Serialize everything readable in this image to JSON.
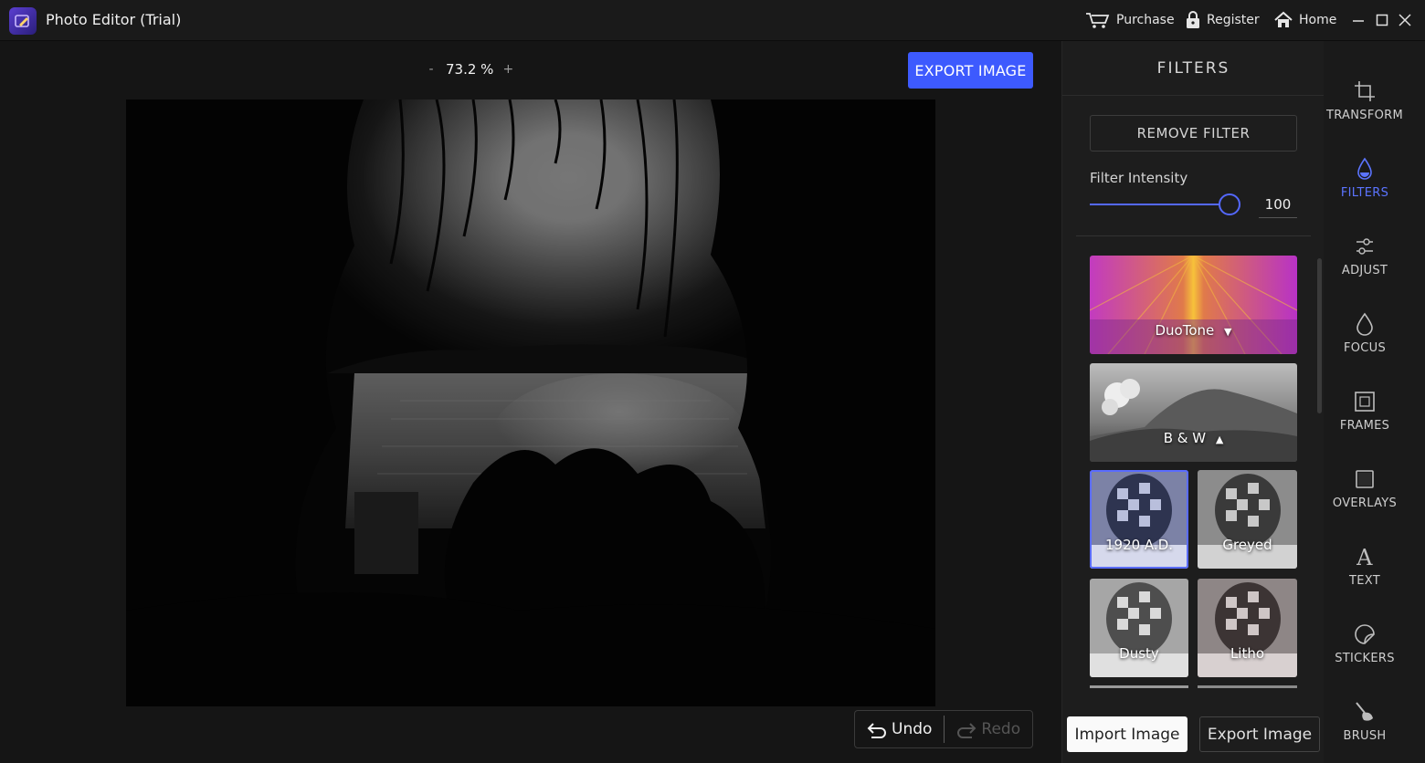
{
  "titlebar": {
    "title": "Photo Editor (Trial)",
    "purchase": "Purchase",
    "register": "Register",
    "home": "Home"
  },
  "workspace": {
    "zoom_minus": "-",
    "zoom_value": "73.2 %",
    "zoom_plus": "+",
    "export_top": "EXPORT IMAGE",
    "undo": "Undo",
    "redo": "Redo"
  },
  "filters_panel": {
    "title": "FILTERS",
    "remove_filter": "REMOVE FILTER",
    "intensity_label": "Filter Intensity",
    "intensity_value": "100",
    "intensity_fraction": 1.0,
    "categories": [
      {
        "label": "DuoTone",
        "arrow": "▼",
        "expanded": false
      },
      {
        "label": "B & W",
        "arrow": "▲",
        "expanded": true
      }
    ],
    "thumbnails": [
      {
        "label": "1920 A.D.",
        "selected": true
      },
      {
        "label": "Greyed",
        "selected": false
      },
      {
        "label": "Dusty",
        "selected": false
      },
      {
        "label": "Litho",
        "selected": false
      }
    ],
    "import_image": "Import Image",
    "export_image": "Export Image"
  },
  "rail": {
    "tools": [
      {
        "label": "TRANSFORM",
        "icon": "crop-icon",
        "active": false
      },
      {
        "label": "FILTERS",
        "icon": "filter-drop-icon",
        "active": true
      },
      {
        "label": "ADJUST",
        "icon": "sliders-icon",
        "active": false
      },
      {
        "label": "FOCUS",
        "icon": "drop-icon",
        "active": false
      },
      {
        "label": "FRAMES",
        "icon": "frame-icon",
        "active": false
      },
      {
        "label": "OVERLAYS",
        "icon": "overlay-icon",
        "active": false
      },
      {
        "label": "TEXT",
        "icon": "text-icon",
        "active": false
      },
      {
        "label": "STICKERS",
        "icon": "sticker-icon",
        "active": false
      },
      {
        "label": "BRUSH",
        "icon": "brush-icon",
        "active": false
      }
    ]
  },
  "colors": {
    "accent": "#3d5afe",
    "active_tool": "#5b74ff",
    "background": "#151515",
    "panel": "#1d1d1d"
  }
}
